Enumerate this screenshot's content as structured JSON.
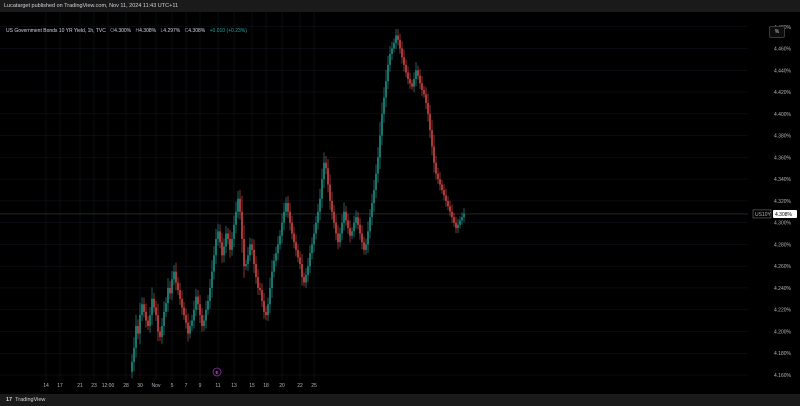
{
  "header": {
    "published_text": "Lucatarget published on TradingView.com, Nov 11, 2024 11:43 UTC+11"
  },
  "legend": {
    "symbol": "US Government Bonds 10 YR Yield, 1h, TVC",
    "o_label": "O",
    "o_value": "4.300%",
    "h_label": "H",
    "h_value": "4.308%",
    "l_label": "L",
    "l_value": "4.297%",
    "c_label": "C",
    "c_value": "4.308%",
    "change": "+0.010 (+0.23%)"
  },
  "currency_button": {
    "label": "%"
  },
  "footer": {
    "logo_mark": "17",
    "brand": "TradingView"
  },
  "colors": {
    "up": "#26a69a",
    "down": "#ef5350",
    "background": "#000000",
    "grid": "#131722"
  },
  "chart_data": {
    "type": "candlestick",
    "symbol": "US10Y",
    "interval": "1h",
    "ylim": [
      4.155,
      4.53
    ],
    "y_ticks": [
      "4.520%",
      "4.500%",
      "4.480%",
      "4.460%",
      "4.440%",
      "4.420%",
      "4.400%",
      "4.380%",
      "4.360%",
      "4.340%",
      "4.320%",
      "4.300%",
      "4.280%",
      "4.260%",
      "4.240%",
      "4.220%",
      "4.200%",
      "4.180%",
      "4.160%"
    ],
    "y_tick_values": [
      4.52,
      4.5,
      4.48,
      4.46,
      4.44,
      4.42,
      4.4,
      4.38,
      4.36,
      4.34,
      4.32,
      4.3,
      4.28,
      4.26,
      4.24,
      4.22,
      4.2,
      4.18,
      4.16
    ],
    "x_ticks": [
      "14",
      "17",
      "21",
      "23",
      "12:00",
      "28",
      "30",
      "Nov",
      "5",
      "7",
      "9",
      "11",
      "13",
      "15",
      "18",
      "20",
      "22",
      "25"
    ],
    "x_tick_index": [
      -42,
      -35,
      -25,
      -18,
      -11,
      -2,
      5,
      13,
      21,
      28,
      35,
      44,
      52,
      61,
      68,
      76,
      85,
      92
    ],
    "horizontal_line": {
      "value": 4.5,
      "label": "4.500%"
    },
    "price_line": {
      "value": 4.308,
      "label": "4.308%",
      "symbol_label": "US10Y"
    },
    "event_marker": "E",
    "path": [
      4.163,
      4.172,
      4.185,
      4.205,
      4.198,
      4.215,
      4.225,
      4.218,
      4.21,
      4.205,
      4.215,
      4.23,
      4.222,
      4.215,
      4.2,
      4.195,
      4.205,
      4.218,
      4.226,
      4.24,
      4.235,
      4.248,
      4.255,
      4.245,
      4.238,
      4.23,
      4.222,
      4.215,
      4.208,
      4.198,
      4.205,
      4.21,
      4.22,
      4.232,
      4.225,
      4.215,
      4.205,
      4.21,
      4.22,
      4.228,
      4.24,
      4.255,
      4.27,
      4.285,
      4.292,
      4.282,
      4.27,
      4.278,
      4.29,
      4.285,
      4.275,
      4.285,
      4.298,
      4.31,
      4.322,
      4.31,
      4.285,
      4.26,
      4.262,
      4.27,
      4.28,
      4.275,
      4.262,
      4.25,
      4.24,
      4.238,
      4.228,
      4.218,
      4.215,
      4.225,
      4.24,
      4.255,
      4.265,
      4.272,
      4.28,
      4.288,
      4.3,
      4.31,
      4.318,
      4.31,
      4.3,
      4.29,
      4.282,
      4.275,
      4.268,
      4.262,
      4.25,
      4.245,
      4.252,
      4.26,
      4.272,
      4.28,
      4.29,
      4.3,
      4.31,
      4.322,
      4.34,
      4.355,
      4.35,
      4.335,
      4.32,
      4.31,
      4.3,
      4.29,
      4.282,
      4.29,
      4.3,
      4.31,
      4.302,
      4.295,
      4.288,
      4.292,
      4.3,
      4.305,
      4.298,
      4.29,
      4.282,
      4.275,
      4.28,
      4.292,
      4.305,
      4.318,
      4.33,
      4.345,
      4.36,
      4.38,
      4.4,
      4.415,
      4.43,
      4.445,
      4.455,
      4.46,
      4.465,
      4.472,
      4.468,
      4.46,
      4.452,
      4.445,
      4.438,
      4.432,
      4.428,
      4.425,
      4.432,
      4.44,
      4.435,
      4.428,
      4.422,
      4.418,
      4.41,
      4.4,
      4.385,
      4.37,
      4.355,
      4.345,
      4.34,
      4.335,
      4.33,
      4.325,
      4.32,
      4.315,
      4.31,
      4.305,
      4.3,
      4.295,
      4.298,
      4.302,
      4.305,
      4.308
    ]
  }
}
